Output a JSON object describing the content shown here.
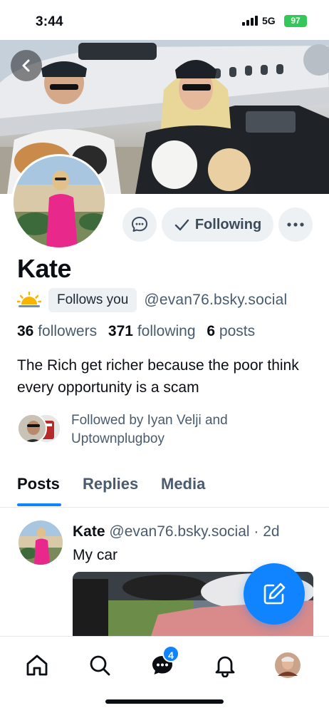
{
  "status_bar": {
    "time": "3:44",
    "network": "5G",
    "battery": "97"
  },
  "profile": {
    "name": "Kate",
    "follows_you_label": "Follows you",
    "handle": "@evan76.bsky.social",
    "stats": {
      "followers_count": "36",
      "followers_label": "followers",
      "following_count": "371",
      "following_label": "following",
      "posts_count": "6",
      "posts_label": "posts"
    },
    "bio": "The Rich get richer because the poor think every opportunity is a scam",
    "followed_by": "Followed by Iyan Velji and Uptownplugboy"
  },
  "actions": {
    "following_label": "Following"
  },
  "tabs": [
    {
      "label": "Posts",
      "active": true
    },
    {
      "label": "Replies",
      "active": false
    },
    {
      "label": "Media",
      "active": false
    }
  ],
  "post": {
    "author": "Kate",
    "handle": "@evan76.bsky.social",
    "time": "· 2d",
    "text": "My car"
  },
  "nav": {
    "messages_badge": "4"
  },
  "colors": {
    "accent": "#1083fe",
    "text_secondary": "#4a5b6e",
    "chip_bg": "#eef1f4"
  },
  "icons": [
    "back-arrow-icon",
    "chat-bubble-icon",
    "checkmark-icon",
    "more-dots-icon",
    "sun-emoji-icon",
    "compose-icon",
    "home-icon",
    "search-icon",
    "messages-icon",
    "bell-icon",
    "profile-avatar-icon"
  ]
}
